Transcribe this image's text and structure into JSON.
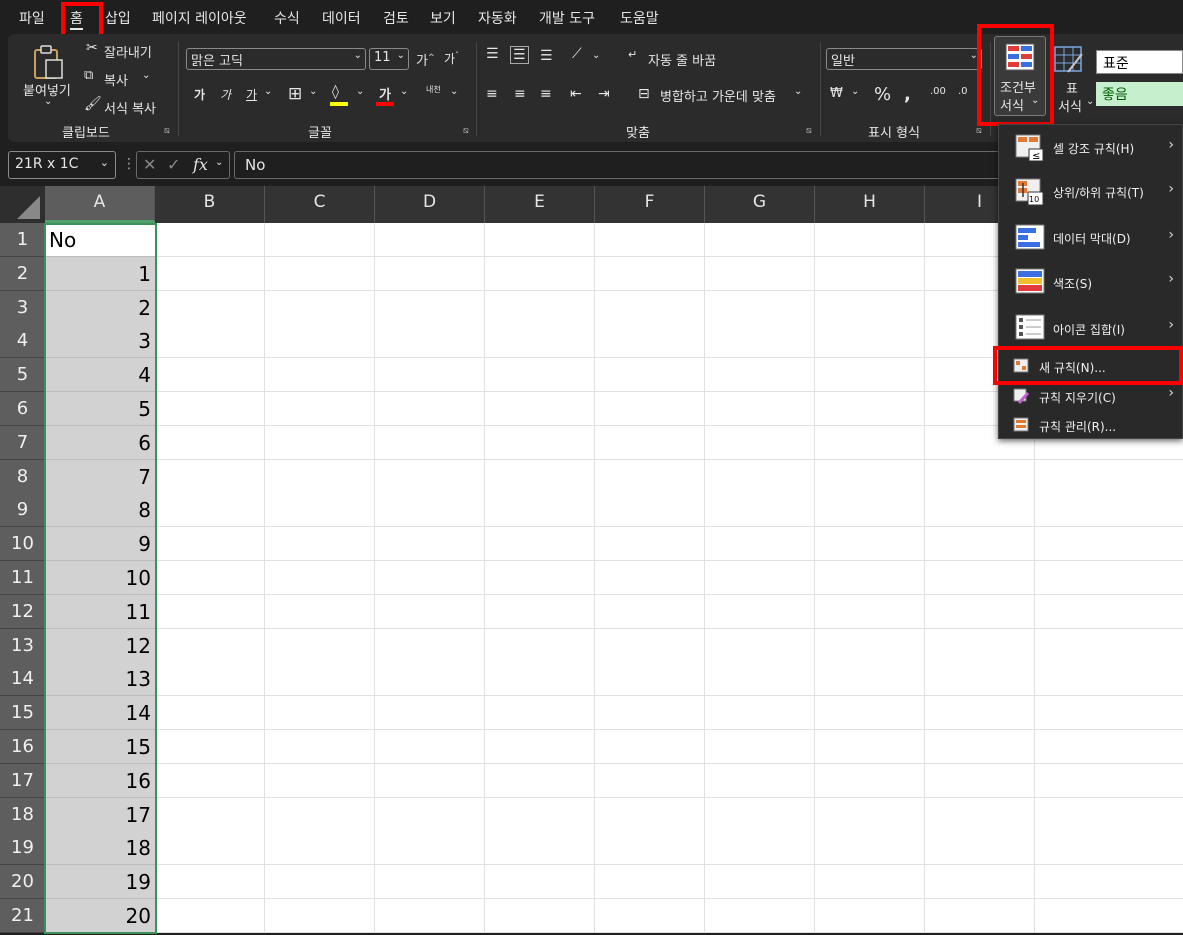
{
  "tabs": [
    "파일",
    "홈",
    "삽입",
    "페이지 레이아웃",
    "수식",
    "데이터",
    "검토",
    "보기",
    "자동화",
    "개발 도구",
    "도움말"
  ],
  "active_tab": "홈",
  "clipboard": {
    "paste_label": "붙여넣기",
    "cut_label": "잘라내기",
    "copy_label": "복사",
    "format_painter_label": "서식 복사",
    "group_label": "클립보드"
  },
  "font": {
    "font_name": "맑은 고딕",
    "font_size": "11",
    "increase_label": "가",
    "decrease_label": "가",
    "bold": "가",
    "italic": "가",
    "underline": "가",
    "font_color_glyph": "가",
    "phonetic_label": "내천",
    "group_label": "글꼴"
  },
  "alignment": {
    "wrap_text_label": "자동 줄 바꿈",
    "merge_center_label": "병합하고 가운데 맞춤",
    "group_label": "맞춤"
  },
  "number": {
    "format_value": "일반",
    "group_label": "표시 형식"
  },
  "styles": {
    "conditional_formatting_label_line1": "조건부",
    "conditional_formatting_label_line2": "서식",
    "format_as_table_label_line1": "표",
    "format_as_table_label_line2": "서식",
    "style_normal": "표준",
    "style_good": "좋음"
  },
  "formula_bar": {
    "name_box": "21R x 1C",
    "fx_label": "fx",
    "formula_value": "No"
  },
  "columns": [
    "A",
    "B",
    "C",
    "D",
    "E",
    "F",
    "G",
    "H",
    "I"
  ],
  "rows": [
    {
      "num": "1",
      "a": "No"
    },
    {
      "num": "2",
      "a": "1"
    },
    {
      "num": "3",
      "a": "2"
    },
    {
      "num": "4",
      "a": "3"
    },
    {
      "num": "5",
      "a": "4"
    },
    {
      "num": "6",
      "a": "5"
    },
    {
      "num": "7",
      "a": "6"
    },
    {
      "num": "8",
      "a": "7"
    },
    {
      "num": "9",
      "a": "8"
    },
    {
      "num": "10",
      "a": "9"
    },
    {
      "num": "11",
      "a": "10"
    },
    {
      "num": "12",
      "a": "11"
    },
    {
      "num": "13",
      "a": "12"
    },
    {
      "num": "14",
      "a": "13"
    },
    {
      "num": "15",
      "a": "14"
    },
    {
      "num": "16",
      "a": "15"
    },
    {
      "num": "17",
      "a": "16"
    },
    {
      "num": "18",
      "a": "17"
    },
    {
      "num": "19",
      "a": "18"
    },
    {
      "num": "20",
      "a": "19"
    },
    {
      "num": "21",
      "a": "20"
    }
  ],
  "cf_menu": {
    "highlight_rules": "셀 강조 규칙(H)",
    "top_bottom_rules": "상위/하위 규칙(T)",
    "data_bars": "데이터 막대(D)",
    "color_scales": "색조(S)",
    "icon_sets": "아이콘 집합(I)",
    "new_rule": "새 규칙(N)...",
    "clear_rules": "규칙 지우기(C)",
    "manage_rules": "규칙 관리(R)...",
    "top_bottom_icon_number": "10"
  },
  "colors": {
    "highlight": "#ff0000",
    "selection_green": "#3f8f5b",
    "good_style_bg": "#c6efce",
    "good_style_text": "#006100"
  }
}
